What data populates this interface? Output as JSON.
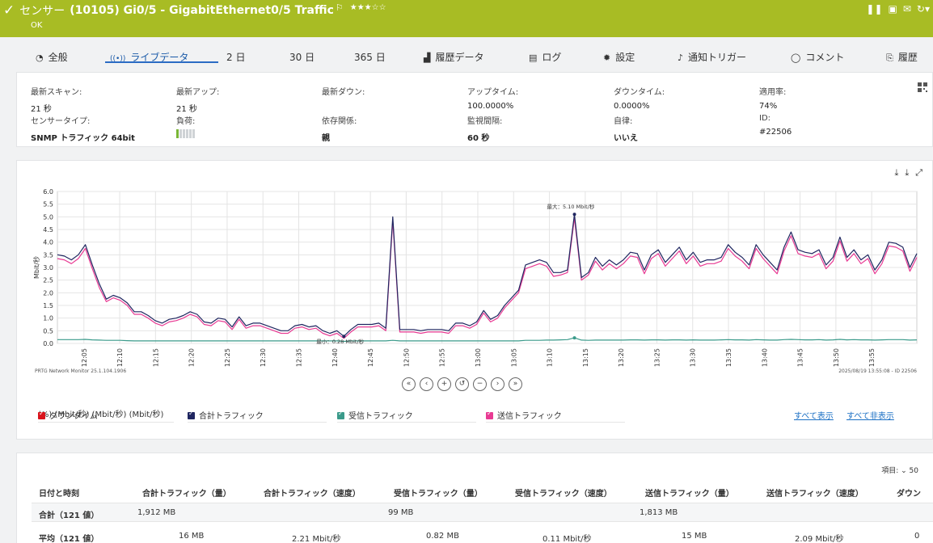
{
  "header": {
    "check_icon": "✓",
    "title_prefix": "センサー",
    "title_main": "(10105) Gi0/5 - GigabitEthernet0/5 Traffic",
    "flag_icon": "⚐",
    "stars": "★★★☆☆",
    "status": "OK",
    "tool_icons": [
      "pause-icon",
      "pdf-icon",
      "mail-icon",
      "refresh-icon"
    ],
    "background_color": "#a8bc24"
  },
  "tabs": [
    {
      "icon": "◔",
      "label": "全般"
    },
    {
      "icon": "((•))",
      "label": "ライブデータ"
    },
    {
      "icon": "",
      "label": "2 日"
    },
    {
      "icon": "",
      "label": "30 日"
    },
    {
      "icon": "",
      "label": "365 日"
    },
    {
      "icon": "▟",
      "label": "履歴データ"
    },
    {
      "icon": "▤",
      "label": "ログ"
    },
    {
      "icon": "✹",
      "label": "設定"
    },
    {
      "icon": "♪",
      "label": "通知トリガー"
    },
    {
      "icon": "◯",
      "label": "コメント"
    },
    {
      "icon": "⎘",
      "label": "履歴"
    }
  ],
  "active_tab": 1,
  "info": {
    "last_scan": {
      "label": "最新スキャン:",
      "value": "21 秒"
    },
    "last_up": {
      "label": "最新アップ:",
      "value": "21 秒"
    },
    "last_down": {
      "label": "最新ダウン:",
      "value": ""
    },
    "uptime": {
      "label": "アップタイム:",
      "value": "100.0000%"
    },
    "downtime": {
      "label": "ダウンタイム:",
      "value": "0.0000%"
    },
    "coverage": {
      "label": "適用率:",
      "value": "74%"
    },
    "sensor_type": {
      "label": "センサータイプ:",
      "value": "SNMP トラフィック 64bit"
    },
    "load": {
      "label": "負荷:",
      "level": 1,
      "max": 6
    },
    "dependency": {
      "label": "依存関係:",
      "value": "親"
    },
    "interval": {
      "label": "監視間隔:",
      "value": "60 秒"
    },
    "autonomous": {
      "label": "自律:",
      "value": "いいえ"
    },
    "id": {
      "label": "ID:",
      "value": "#22506"
    }
  },
  "chart_footer": {
    "left": "PRTG Network Monitor 25.1.104.1906",
    "right": "2025/08/19 13:55:08 - ID 22506"
  },
  "chart_data": {
    "type": "line",
    "ylabel": "Mbit/秒",
    "ylim": [
      0,
      6.0
    ],
    "yticks": [
      "0.0",
      "0.5",
      "1.0",
      "1.5",
      "2.0",
      "2.5",
      "3.0",
      "3.5",
      "4.0",
      "4.5",
      "5.0",
      "5.5",
      "6.0"
    ],
    "xticks": [
      "12:05",
      "12:10",
      "12:15",
      "12:20",
      "12:25",
      "12:30",
      "12:35",
      "12:40",
      "12:45",
      "12:50",
      "12:55",
      "13:00",
      "13:05",
      "13:10",
      "13:15",
      "13:20",
      "13:25",
      "13:30",
      "13:35",
      "13:40",
      "13:45",
      "13:50",
      "13:55"
    ],
    "x_start_min": 0,
    "x_end_min": 120,
    "annotations": {
      "max": "最大：5.10 Mbit/秒",
      "min": "最小：0.28 Mbit/秒"
    },
    "series": [
      {
        "name": "合計トラフィック",
        "color": "#1f2660",
        "values": [
          3.5,
          3.45,
          3.3,
          3.5,
          3.9,
          3.1,
          2.35,
          1.75,
          1.9,
          1.8,
          1.6,
          1.25,
          1.25,
          1.1,
          0.9,
          0.8,
          0.95,
          1.0,
          1.1,
          1.25,
          1.15,
          0.85,
          0.8,
          1.0,
          0.95,
          0.65,
          1.05,
          0.7,
          0.8,
          0.8,
          0.7,
          0.6,
          0.5,
          0.5,
          0.7,
          0.75,
          0.65,
          0.7,
          0.5,
          0.4,
          0.5,
          0.28,
          0.55,
          0.75,
          0.75,
          0.75,
          0.8,
          0.6,
          5.0,
          0.55,
          0.55,
          0.55,
          0.5,
          0.55,
          0.55,
          0.55,
          0.5,
          0.8,
          0.8,
          0.7,
          0.85,
          1.3,
          0.95,
          1.1,
          1.5,
          1.8,
          2.1,
          3.1,
          3.2,
          3.3,
          3.2,
          2.8,
          2.8,
          2.9,
          5.1,
          2.6,
          2.8,
          3.4,
          3.05,
          3.3,
          3.1,
          3.3,
          3.6,
          3.55,
          2.9,
          3.5,
          3.7,
          3.2,
          3.5,
          3.8,
          3.3,
          3.6,
          3.2,
          3.3,
          3.3,
          3.4,
          3.9,
          3.6,
          3.4,
          3.1,
          3.9,
          3.5,
          3.2,
          2.9,
          3.8,
          4.4,
          3.7,
          3.6,
          3.55,
          3.7,
          3.1,
          3.4,
          4.2,
          3.4,
          3.7,
          3.3,
          3.5,
          2.9,
          3.3,
          4.0,
          3.95,
          3.8,
          3.0,
          3.55
        ]
      },
      {
        "name": "送信トラフィック",
        "color": "#e83a93",
        "values": [
          3.35,
          3.3,
          3.15,
          3.35,
          3.75,
          2.95,
          2.2,
          1.65,
          1.8,
          1.7,
          1.5,
          1.15,
          1.15,
          1.0,
          0.8,
          0.7,
          0.85,
          0.9,
          1.0,
          1.15,
          1.05,
          0.75,
          0.7,
          0.9,
          0.85,
          0.55,
          0.95,
          0.6,
          0.7,
          0.7,
          0.6,
          0.5,
          0.4,
          0.4,
          0.6,
          0.65,
          0.55,
          0.6,
          0.4,
          0.3,
          0.4,
          0.2,
          0.45,
          0.65,
          0.65,
          0.65,
          0.7,
          0.5,
          4.85,
          0.45,
          0.45,
          0.45,
          0.4,
          0.45,
          0.45,
          0.45,
          0.4,
          0.7,
          0.7,
          0.6,
          0.75,
          1.2,
          0.85,
          1.0,
          1.4,
          1.7,
          2.0,
          2.95,
          3.05,
          3.15,
          3.05,
          2.65,
          2.7,
          2.8,
          4.95,
          2.5,
          2.7,
          3.25,
          2.9,
          3.15,
          2.95,
          3.15,
          3.45,
          3.4,
          2.75,
          3.35,
          3.55,
          3.05,
          3.35,
          3.65,
          3.15,
          3.45,
          3.05,
          3.15,
          3.15,
          3.25,
          3.75,
          3.45,
          3.25,
          2.95,
          3.75,
          3.35,
          3.05,
          2.75,
          3.65,
          4.25,
          3.55,
          3.45,
          3.4,
          3.55,
          2.95,
          3.25,
          4.05,
          3.25,
          3.55,
          3.15,
          3.35,
          2.75,
          3.15,
          3.85,
          3.8,
          3.65,
          2.85,
          3.4
        ]
      },
      {
        "name": "受信トラフィック",
        "color": "#3a9a8a",
        "values": [
          0.15,
          0.15,
          0.15,
          0.15,
          0.16,
          0.14,
          0.13,
          0.12,
          0.12,
          0.12,
          0.11,
          0.1,
          0.1,
          0.1,
          0.1,
          0.1,
          0.1,
          0.1,
          0.1,
          0.1,
          0.1,
          0.1,
          0.1,
          0.1,
          0.1,
          0.1,
          0.1,
          0.1,
          0.1,
          0.1,
          0.1,
          0.1,
          0.1,
          0.1,
          0.1,
          0.1,
          0.1,
          0.1,
          0.1,
          0.1,
          0.1,
          0.08,
          0.1,
          0.1,
          0.1,
          0.1,
          0.1,
          0.1,
          0.12,
          0.1,
          0.1,
          0.1,
          0.1,
          0.1,
          0.1,
          0.1,
          0.1,
          0.1,
          0.1,
          0.1,
          0.1,
          0.1,
          0.1,
          0.1,
          0.1,
          0.1,
          0.1,
          0.12,
          0.12,
          0.12,
          0.13,
          0.13,
          0.14,
          0.15,
          0.22,
          0.13,
          0.12,
          0.13,
          0.13,
          0.13,
          0.13,
          0.13,
          0.14,
          0.14,
          0.13,
          0.14,
          0.14,
          0.13,
          0.14,
          0.14,
          0.13,
          0.14,
          0.13,
          0.13,
          0.13,
          0.14,
          0.15,
          0.14,
          0.14,
          0.13,
          0.15,
          0.14,
          0.13,
          0.13,
          0.15,
          0.16,
          0.15,
          0.14,
          0.14,
          0.15,
          0.13,
          0.14,
          0.16,
          0.14,
          0.15,
          0.14,
          0.14,
          0.13,
          0.14,
          0.15,
          0.15,
          0.15,
          0.13,
          0.14
        ]
      }
    ]
  },
  "nav_buttons": [
    "«",
    "‹",
    "+",
    "↺",
    "−",
    "›",
    "»"
  ],
  "legend": [
    {
      "label": "ダウンタイム",
      "unit": "(%)",
      "color": "#d9141c"
    },
    {
      "label": "合計トラフィック",
      "unit": "(Mbit/秒)",
      "color": "#1f2660"
    },
    {
      "label": "受信トラフィック",
      "unit": "(Mbit/秒)",
      "color": "#3a9a8a"
    },
    {
      "label": "送信トラフィック",
      "unit": "(Mbit/秒)",
      "color": "#e83a93"
    }
  ],
  "legend_links": {
    "show_all": "すべて表示",
    "hide_all": "すべて非表示"
  },
  "table": {
    "items_label": "項目: ⌄ 50",
    "headers": [
      "日付と時刻",
      "合計トラフィック（量）",
      "合計トラフィック（速度）",
      "受信トラフィック（量）",
      "受信トラフィック（速度）",
      "送信トラフィック（量）",
      "送信トラフィック（速度）",
      "ダウン"
    ],
    "rows": [
      {
        "label": "合計（121 値）",
        "cells": [
          "1,912 MB",
          "",
          "99 MB",
          "",
          "1,813 MB",
          "",
          ""
        ]
      },
      {
        "label": "平均（121 値）",
        "cells": [
          "16 MB",
          "2.21 Mbit/秒",
          "0.82 MB",
          "0.11 Mbit/秒",
          "15 MB",
          "2.09 Mbit/秒",
          "0"
        ]
      }
    ]
  }
}
